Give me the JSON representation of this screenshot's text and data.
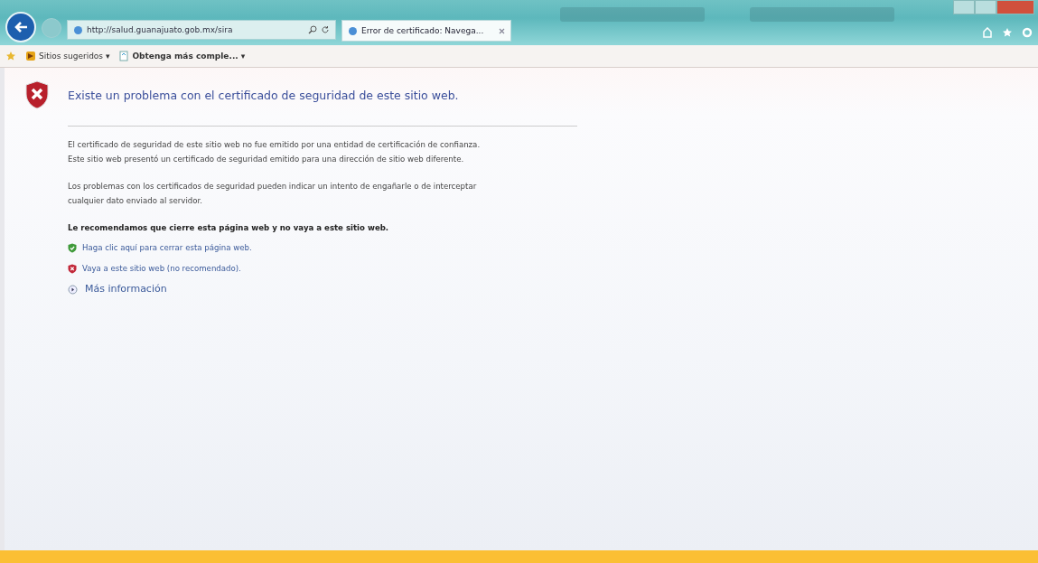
{
  "address_bar": {
    "url": "http://salud.guanajuato.gob.mx/sira"
  },
  "tabs": [
    {
      "label": "Error de certificado: Navega...",
      "selected": true
    }
  ],
  "favorites_bar": [
    {
      "label": "Sitios sugeridos ▾",
      "kind": "suggested"
    },
    {
      "label": "Obtenga más comple... ▾",
      "kind": "gallery"
    }
  ],
  "error": {
    "title": "Existe un problema con el certificado de seguridad de este sitio web.",
    "paragraphs": [
      "El certificado de seguridad de este sitio web no fue emitido por una entidad de certificación de confianza.\nEste sitio web presentó un certificado de seguridad emitido para una dirección de sitio web diferente.",
      "Los problemas con los certificados de seguridad pueden indicar un intento de engañarle o de interceptar\ncualquier dato enviado al servidor."
    ],
    "recommendation": "Le recomendamos que cierre esta página web y no vaya a este sitio web.",
    "links": [
      {
        "label": "Haga clic aquí para cerrar esta página web.",
        "kind": "safe"
      },
      {
        "label": "Vaya a este sitio web (no recomendado).",
        "kind": "unsafe"
      }
    ],
    "more_info": "Más información"
  }
}
